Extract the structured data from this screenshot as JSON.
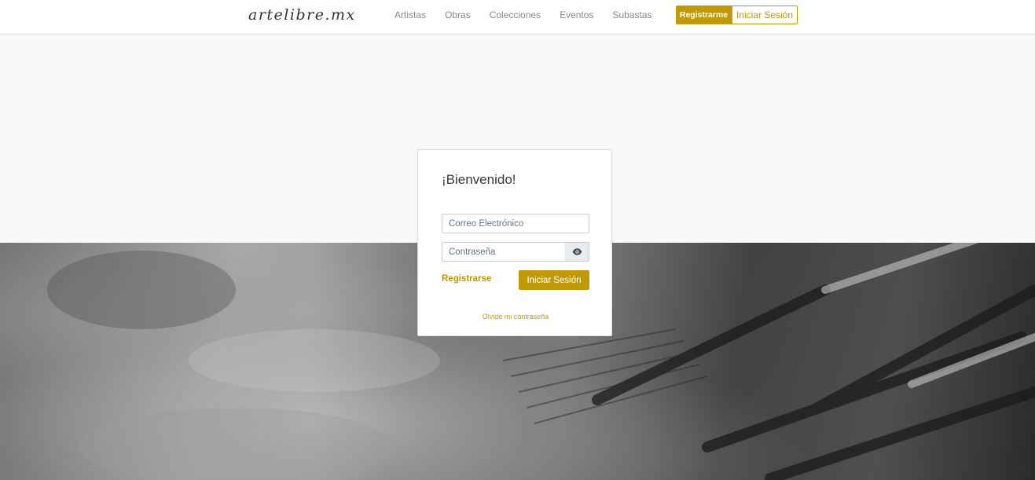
{
  "nav": {
    "logo": "artelibre.mx",
    "links": [
      "Artistas",
      "Obras",
      "Colecciones",
      "Eventos",
      "Subastas"
    ],
    "register_label": "Registrarme",
    "login_label": "Iniciar Sesión"
  },
  "login": {
    "title": "¡Bienvenido!",
    "email_placeholder": "Correo Electrónico",
    "password_placeholder": "Contraseña",
    "eye_icon": "eye-icon",
    "register_link": "Registrarse",
    "submit_label": "Iniciar Sesión",
    "forgot_link": "Olvidé mi contraseña"
  },
  "colors": {
    "accent": "#c09a06",
    "page_bg": "#f8f9fa"
  }
}
